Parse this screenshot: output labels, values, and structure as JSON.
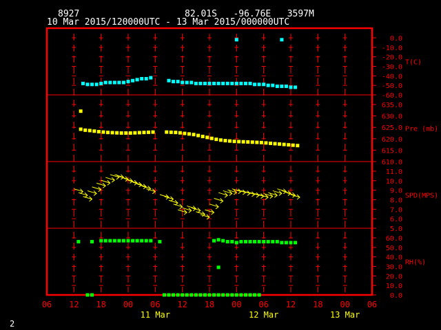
{
  "header": {
    "station": "8927",
    "location": "82.01S   -96.76E   3597M",
    "range": "10 Mar 2015/120000UTC - 13 Mar 2015/000000UTC"
  },
  "footer": {
    "page_number": "2"
  },
  "chart_data": {
    "type": "scatter",
    "x_axis": {
      "unit": "hours since 10 Mar 2015 06UTC",
      "range": [
        0,
        72
      ],
      "tick_values": [
        0,
        6,
        12,
        18,
        24,
        30,
        36,
        42,
        48,
        54,
        60,
        66,
        72
      ],
      "tick_labels": [
        "06",
        "12",
        "18",
        "00",
        "06",
        "12",
        "18",
        "00",
        "06",
        "12",
        "18",
        "00",
        "06"
      ],
      "date_labels": [
        {
          "x": 24,
          "text": "11 Mar"
        },
        {
          "x": 48,
          "text": "12 Mar"
        },
        {
          "x": 66,
          "text": "13 Mar"
        }
      ]
    },
    "panels": [
      {
        "name": "temperature",
        "label": "T(C)",
        "range": [
          -60,
          0
        ],
        "tick_labels": [
          "0.0",
          "-10.0",
          "-20.0",
          "-30.0",
          "-40.0",
          "-50.0",
          "-60.0"
        ],
        "color": "#00ffff",
        "points": [
          [
            8,
            -48
          ],
          [
            9,
            -49
          ],
          [
            10,
            -49
          ],
          [
            11,
            -49
          ],
          [
            12,
            -48
          ],
          [
            13,
            -47
          ],
          [
            14,
            -47
          ],
          [
            15,
            -47
          ],
          [
            16,
            -47
          ],
          [
            17,
            -47
          ],
          [
            18,
            -46
          ],
          [
            19,
            -45
          ],
          [
            20,
            -44
          ],
          [
            21,
            -43
          ],
          [
            22,
            -43
          ],
          [
            23,
            -42
          ],
          [
            27,
            -45
          ],
          [
            28,
            -46
          ],
          [
            29,
            -46
          ],
          [
            30,
            -47
          ],
          [
            31,
            -47
          ],
          [
            32,
            -47
          ],
          [
            33,
            -48
          ],
          [
            34,
            -48
          ],
          [
            35,
            -48
          ],
          [
            36,
            -48
          ],
          [
            37,
            -48
          ],
          [
            38,
            -48
          ],
          [
            39,
            -48
          ],
          [
            40,
            -48
          ],
          [
            41,
            -48
          ],
          [
            42,
            -48
          ],
          [
            43,
            -48
          ],
          [
            44,
            -48
          ],
          [
            45,
            -48
          ],
          [
            46,
            -49
          ],
          [
            47,
            -49
          ],
          [
            48,
            -49
          ],
          [
            49,
            -50
          ],
          [
            50,
            -50
          ],
          [
            51,
            -51
          ],
          [
            52,
            -51
          ],
          [
            53,
            -51
          ],
          [
            54,
            -52
          ],
          [
            55,
            -52
          ],
          [
            42,
            -2
          ],
          [
            52,
            -2
          ]
        ]
      },
      {
        "name": "pressure",
        "label": "Pre (mb)",
        "range": [
          610,
          640
        ],
        "tick_labels": [
          "635.0",
          "630.0",
          "625.0",
          "620.0",
          "615.0",
          "610.0"
        ],
        "color": "#ffff00",
        "points": [
          [
            7.5,
            636.5
          ],
          [
            7.5,
            627
          ],
          [
            8.5,
            626.5
          ],
          [
            9.5,
            626.3
          ],
          [
            10.5,
            626
          ],
          [
            11.5,
            625.7
          ],
          [
            12.5,
            625.5
          ],
          [
            13.5,
            625.3
          ],
          [
            14.5,
            625.2
          ],
          [
            15.5,
            625.1
          ],
          [
            16.5,
            625
          ],
          [
            17.5,
            625
          ],
          [
            18.5,
            625
          ],
          [
            19.5,
            625.1
          ],
          [
            20.5,
            625.2
          ],
          [
            21.5,
            625.3
          ],
          [
            22.5,
            625.4
          ],
          [
            23.5,
            625.5
          ],
          [
            26.5,
            625.5
          ],
          [
            27.5,
            625.4
          ],
          [
            28.5,
            625.3
          ],
          [
            29.5,
            625.1
          ],
          [
            30.5,
            624.8
          ],
          [
            31.5,
            624.5
          ],
          [
            32.5,
            624.2
          ],
          [
            33.5,
            623.7
          ],
          [
            34.5,
            623.2
          ],
          [
            35.5,
            622.7
          ],
          [
            36.5,
            622.2
          ],
          [
            37.5,
            621.7
          ],
          [
            38.5,
            621.3
          ],
          [
            39.5,
            621
          ],
          [
            40.5,
            620.8
          ],
          [
            41.5,
            620.6
          ],
          [
            42.5,
            620.5
          ],
          [
            43.5,
            620.4
          ],
          [
            44.5,
            620.3
          ],
          [
            45.5,
            620.2
          ],
          [
            46.5,
            620.1
          ],
          [
            47.5,
            620
          ],
          [
            48.5,
            619.8
          ],
          [
            49.5,
            619.6
          ],
          [
            50.5,
            619.4
          ],
          [
            51.5,
            619.2
          ],
          [
            52.5,
            619
          ],
          [
            53.5,
            618.8
          ],
          [
            54.5,
            618.6
          ],
          [
            55.5,
            618.4
          ]
        ]
      },
      {
        "name": "wind",
        "label": "SPD(MPS)",
        "range": [
          5,
          11
        ],
        "tick_labels": [
          "11.0",
          "10.0",
          "9.0",
          "8.0",
          "7.0",
          "6.0",
          "5.0"
        ],
        "color": "#ffff00",
        "points": [
          [
            7,
            9.0
          ],
          [
            8,
            8.6
          ],
          [
            9,
            8.2
          ],
          [
            10,
            8.8
          ],
          [
            11,
            9.2
          ],
          [
            12,
            9.6
          ],
          [
            13,
            9.9
          ],
          [
            14,
            10.2
          ],
          [
            15,
            10.5
          ],
          [
            16,
            10.5
          ],
          [
            17,
            10.3
          ],
          [
            18,
            10.1
          ],
          [
            19,
            9.9
          ],
          [
            20,
            9.7
          ],
          [
            21,
            9.5
          ],
          [
            22,
            9.3
          ],
          [
            23,
            9.0
          ],
          [
            26,
            8.4
          ],
          [
            27,
            8.2
          ],
          [
            28,
            7.8
          ],
          [
            29,
            7.4
          ],
          [
            30,
            6.8
          ],
          [
            31,
            7.0
          ],
          [
            32,
            7.2
          ],
          [
            33,
            7.0
          ],
          [
            34,
            6.6
          ],
          [
            35,
            6.3
          ],
          [
            36,
            6.8
          ],
          [
            37,
            7.4
          ],
          [
            38,
            8.0
          ],
          [
            39,
            8.6
          ],
          [
            40,
            8.8
          ],
          [
            41,
            8.9
          ],
          [
            42,
            9.0
          ],
          [
            43,
            8.9
          ],
          [
            44,
            8.8
          ],
          [
            45,
            8.7
          ],
          [
            46,
            8.6
          ],
          [
            47,
            8.5
          ],
          [
            48,
            8.4
          ],
          [
            49,
            8.5
          ],
          [
            50,
            8.6
          ],
          [
            51,
            8.8
          ],
          [
            52,
            9.0
          ],
          [
            53,
            8.8
          ],
          [
            54,
            8.6
          ],
          [
            55,
            8.4
          ]
        ]
      },
      {
        "name": "humidity",
        "label": "RH(%)",
        "range": [
          0,
          60
        ],
        "tick_labels": [
          "60.0",
          "50.0",
          "40.0",
          "30.0",
          "20.0",
          "10.0",
          "0.0"
        ],
        "color": "#00ff00",
        "points": [
          [
            7,
            56
          ],
          [
            10,
            56
          ],
          [
            12,
            57
          ],
          [
            13,
            57
          ],
          [
            14,
            57
          ],
          [
            15,
            57
          ],
          [
            16,
            57
          ],
          [
            17,
            57
          ],
          [
            18,
            57
          ],
          [
            19,
            57
          ],
          [
            20,
            57
          ],
          [
            21,
            57
          ],
          [
            22,
            57
          ],
          [
            23,
            57
          ],
          [
            25,
            56
          ],
          [
            37,
            57
          ],
          [
            38,
            58
          ],
          [
            39,
            57
          ],
          [
            40,
            56
          ],
          [
            41,
            56
          ],
          [
            42,
            55
          ],
          [
            43,
            56
          ],
          [
            44,
            56
          ],
          [
            45,
            56
          ],
          [
            46,
            56
          ],
          [
            47,
            56
          ],
          [
            48,
            56
          ],
          [
            49,
            56
          ],
          [
            50,
            56
          ],
          [
            51,
            56
          ],
          [
            52,
            55
          ],
          [
            53,
            55
          ],
          [
            54,
            55
          ],
          [
            55,
            55
          ],
          [
            38,
            29
          ],
          [
            9,
            0
          ],
          [
            10,
            0
          ],
          [
            26,
            0
          ],
          [
            27,
            0
          ],
          [
            28,
            0
          ],
          [
            29,
            0
          ],
          [
            30,
            0
          ],
          [
            31,
            0
          ],
          [
            32,
            0
          ],
          [
            33,
            0
          ],
          [
            34,
            0
          ],
          [
            35,
            0
          ],
          [
            36,
            0
          ],
          [
            37,
            0
          ],
          [
            38,
            0
          ],
          [
            39,
            0
          ],
          [
            40,
            0
          ],
          [
            41,
            0
          ],
          [
            42,
            0
          ],
          [
            43,
            0
          ],
          [
            44,
            0
          ],
          [
            45,
            0
          ],
          [
            46,
            0
          ],
          [
            47,
            0
          ]
        ]
      }
    ]
  }
}
